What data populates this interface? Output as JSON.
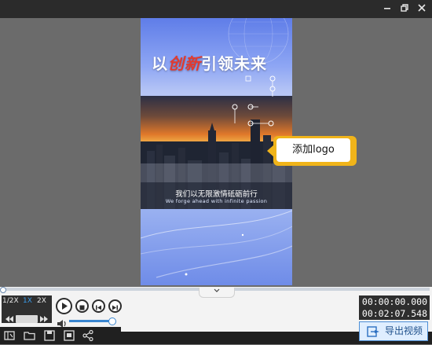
{
  "window": {
    "controls": [
      "minimize-icon",
      "restore-icon",
      "close-icon"
    ]
  },
  "video": {
    "title_pre": "以",
    "title_red": "创新",
    "title_post": "引领未来",
    "subtitle_cn": "我们以无限激情砥砺前行",
    "subtitle_en": "We forge ahead with infinite passion"
  },
  "callout": {
    "label": "添加logo"
  },
  "playback": {
    "speeds": [
      "1/2X",
      "1X",
      "2X"
    ],
    "active_speed": "1X",
    "current_time": "00:00:00.000",
    "total_time": "00:02:07.548",
    "volume": 0.9,
    "progress": 0.0
  },
  "toolbar": {
    "icons": [
      "clip-icon",
      "open-folder-icon",
      "save-icon",
      "save-as-icon",
      "share-icon"
    ],
    "export_label": "导出视频"
  },
  "colors": {
    "accent": "#3a86d0",
    "callout": "#f0b41a",
    "title_highlight": "#e23a2f"
  }
}
